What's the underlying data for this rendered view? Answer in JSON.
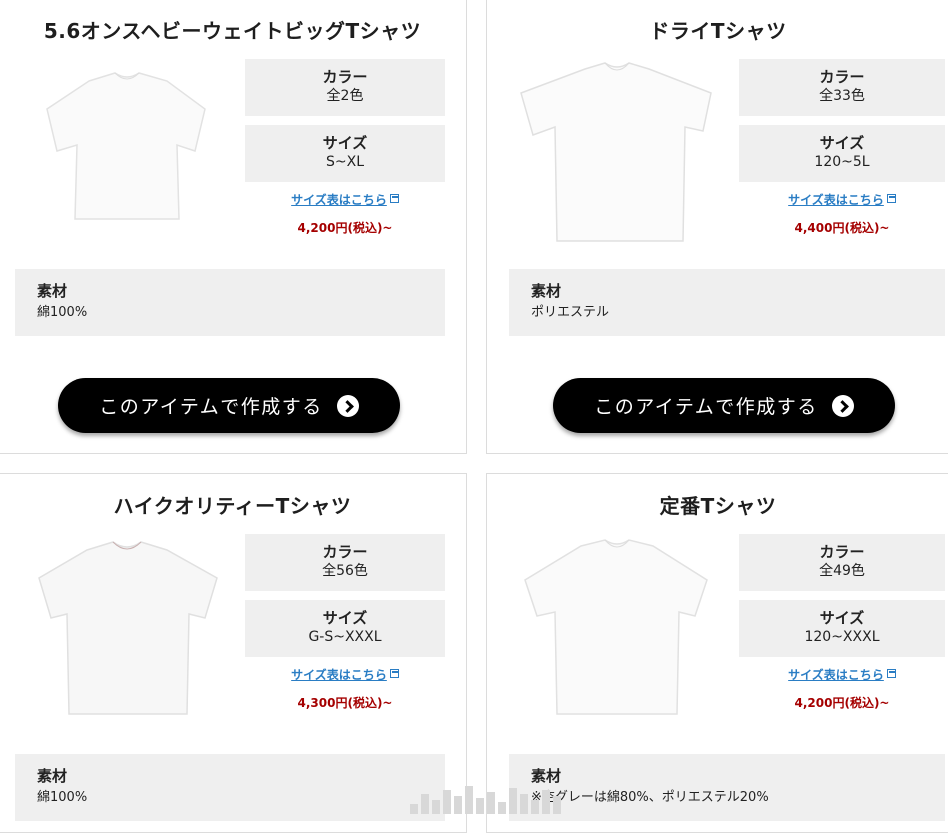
{
  "products": [
    {
      "title": "5.6オンスヘビーウェイトビッグTシャツ",
      "color_label": "カラー",
      "color_value": "全2色",
      "size_label": "サイズ",
      "size_value": "S~XL",
      "size_link": "サイズ表はこちら",
      "price": "4,200円(税込)~",
      "material_label": "素材",
      "material_value": "綿100%",
      "cta": "このアイテムで作成する"
    },
    {
      "title": "ドライTシャツ",
      "color_label": "カラー",
      "color_value": "全33色",
      "size_label": "サイズ",
      "size_value": "120~5L",
      "size_link": "サイズ表はこちら",
      "price": "4,400円(税込)~",
      "material_label": "素材",
      "material_value": "ポリエステル",
      "cta": "このアイテムで作成する"
    },
    {
      "title": "ハイクオリティーTシャツ",
      "color_label": "カラー",
      "color_value": "全56色",
      "size_label": "サイズ",
      "size_value": "G-S~XXXL",
      "size_link": "サイズ表はこちら",
      "price": "4,300円(税込)~",
      "material_label": "素材",
      "material_value": "綿100%"
    },
    {
      "title": "定番Tシャツ",
      "color_label": "カラー",
      "color_value": "全49色",
      "size_label": "サイズ",
      "size_value": "120~XXXL",
      "size_link": "サイズ表はこちら",
      "price": "4,200円(税込)~",
      "material_label": "素材",
      "material_value": "※杢グレーは綿80%、ポリエステル20%"
    }
  ]
}
